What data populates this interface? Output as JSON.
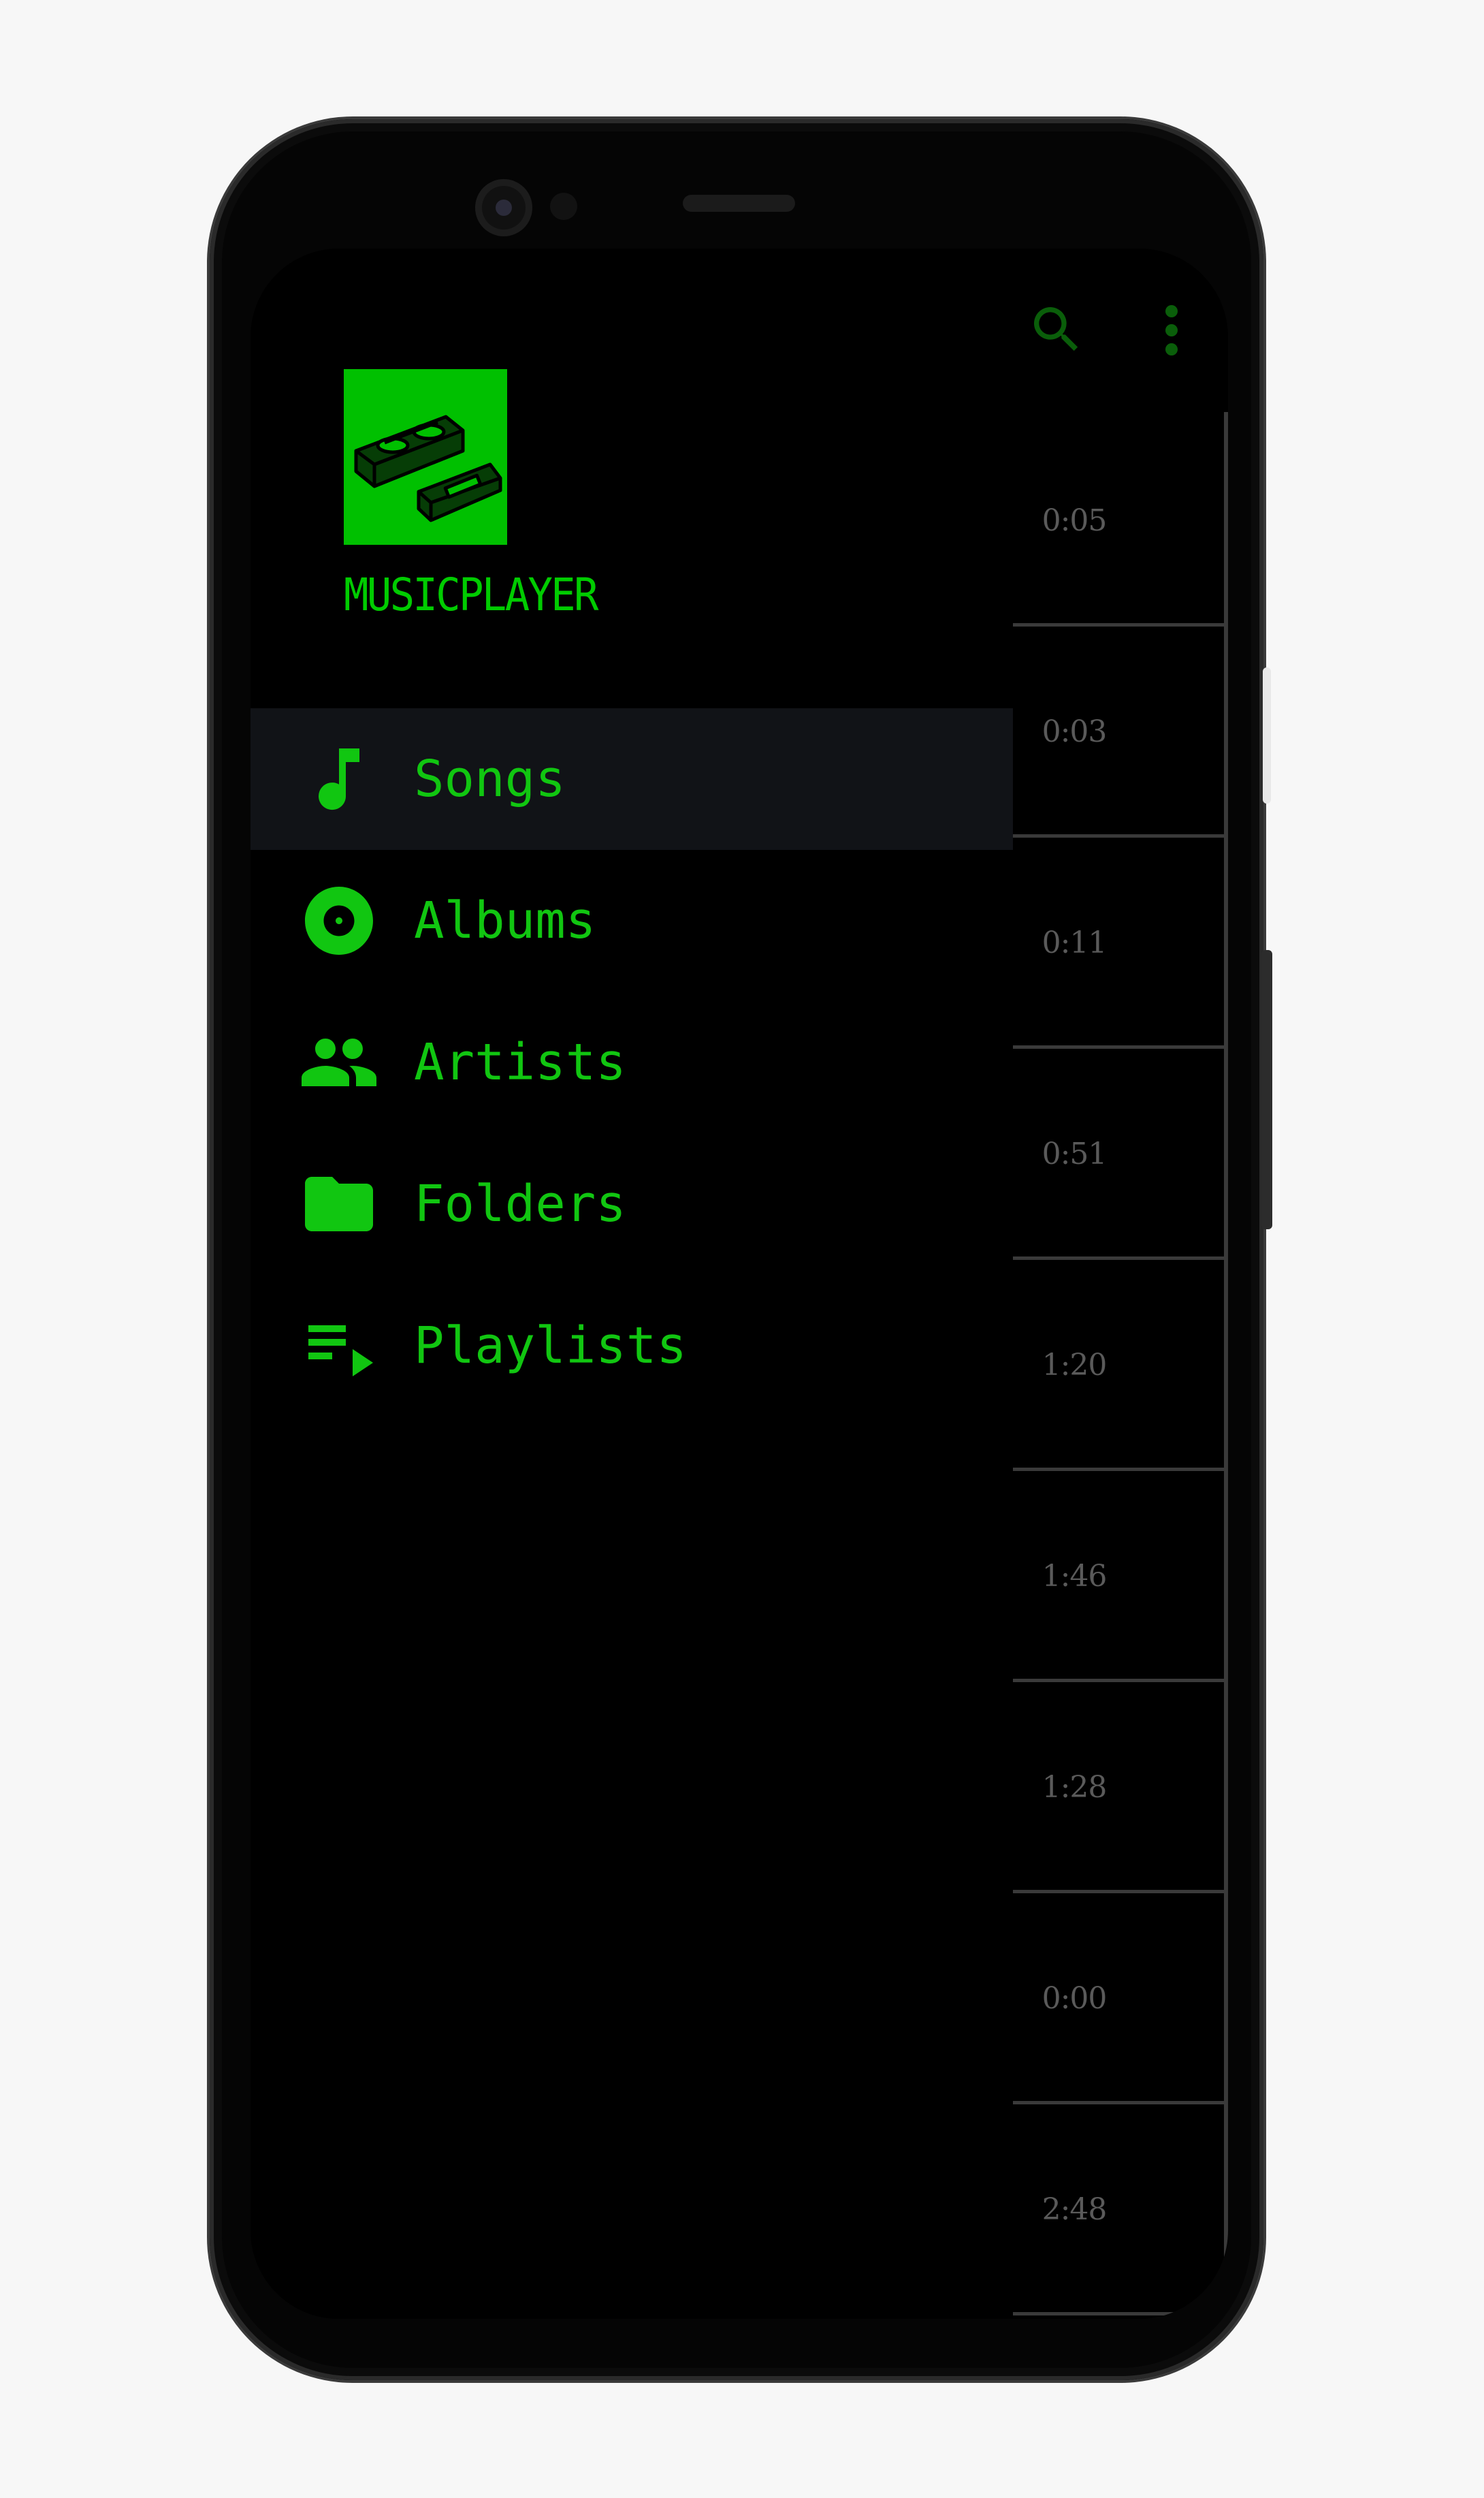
{
  "app": {
    "name": "MUSICPLAYER"
  },
  "nav": {
    "items": [
      {
        "id": "songs",
        "label": "Songs",
        "icon": "music-note-icon",
        "active": true
      },
      {
        "id": "albums",
        "label": "Albums",
        "icon": "album-disc-icon",
        "active": false
      },
      {
        "id": "artists",
        "label": "Artists",
        "icon": "people-icon",
        "active": false
      },
      {
        "id": "folders",
        "label": "Folders",
        "icon": "folder-icon",
        "active": false
      },
      {
        "id": "playlists",
        "label": "Playlists",
        "icon": "playlist-icon",
        "active": false
      }
    ]
  },
  "toolbar": {
    "search_icon": "search-icon",
    "more_icon": "more-vert-icon"
  },
  "songs": {
    "durations": [
      "0:05",
      "0:03",
      "0:11",
      "0:51",
      "1:20",
      "1:46",
      "1:28",
      "0:00",
      "2:48"
    ]
  },
  "colors": {
    "accent": "#00c000",
    "background": "#000000",
    "active_item": "#111317",
    "divider": "#3a3a3a",
    "muted_text": "#5a5a5a"
  }
}
